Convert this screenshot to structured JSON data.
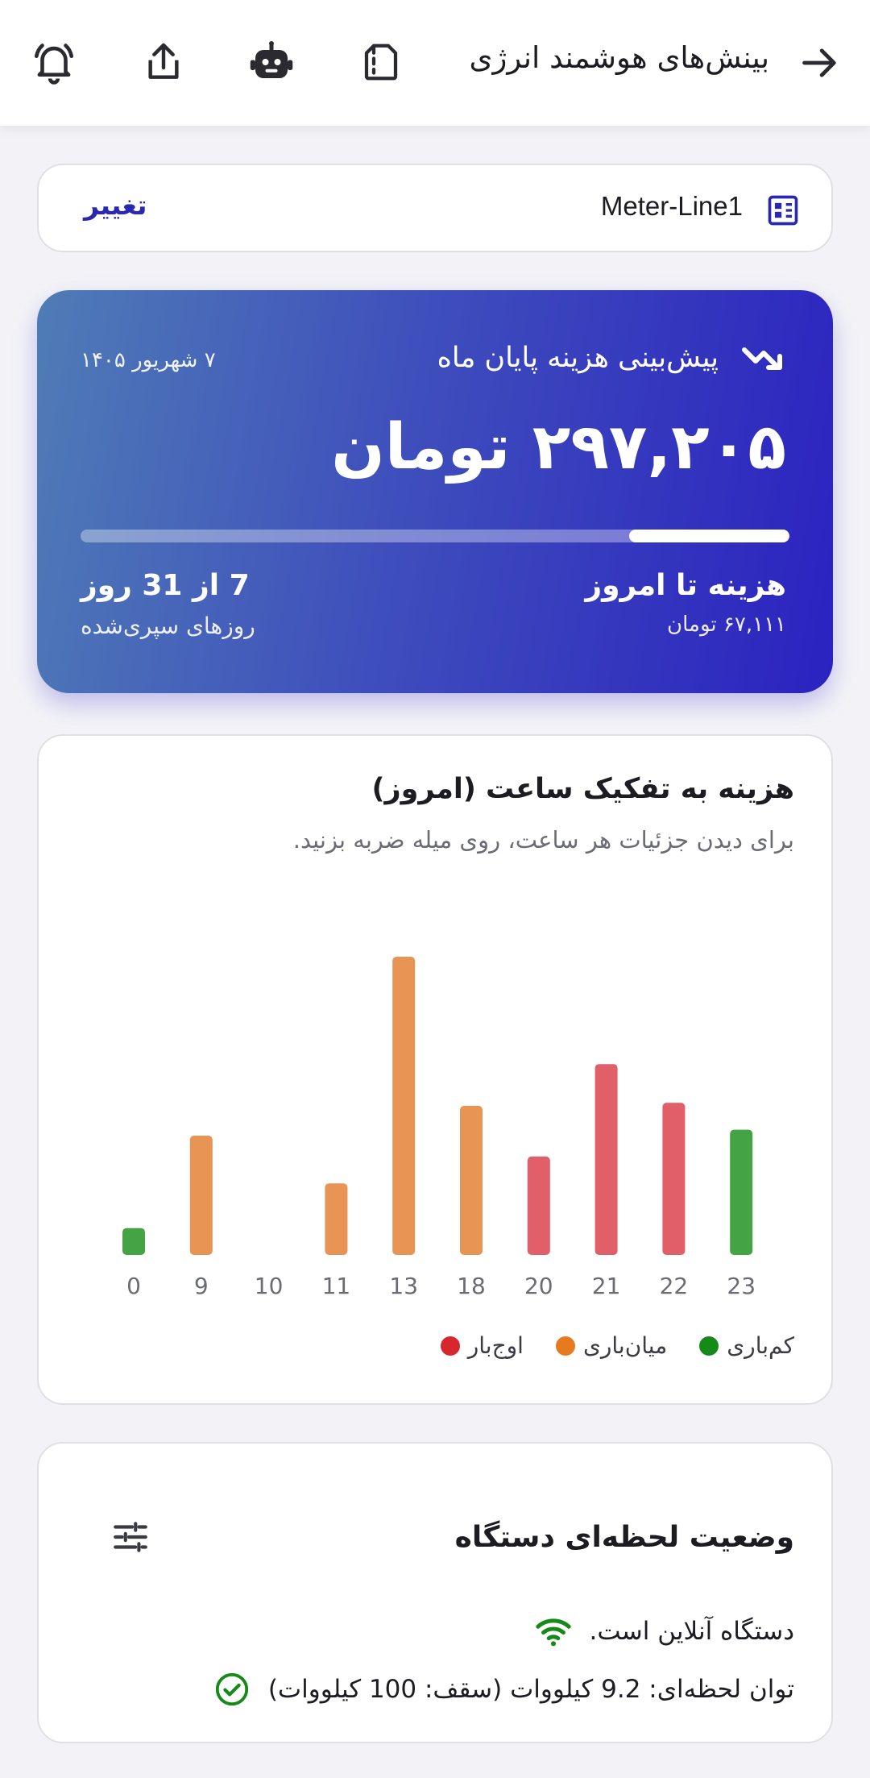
{
  "header": {
    "title": "بینش‌های هوشمند انرژی",
    "icons": [
      "arrow-forward-icon",
      "document-icon",
      "robot-icon",
      "share-icon",
      "bell-icon"
    ]
  },
  "meter": {
    "name": "Meter-Line1",
    "change_label": "تغییر"
  },
  "forecast": {
    "title": "پیش‌بینی هزینه پایان ماه",
    "date": "۷ شهریور ۱۴۰۵",
    "amount": "۲۹۷,۲۰۵ تومان",
    "progress": 0.226,
    "cost_label": "هزینه تا امروز",
    "cost_value": "۶۷,۱۱۱ تومان",
    "days_label": "7 از 31 روز",
    "days_sub": "روزهای سپری‌شده"
  },
  "chart": {
    "title": "هزینه به تفکیک ساعت (امروز)",
    "subtitle": "برای دیدن جزئیات هر ساعت، روی میله ضربه بزنید.",
    "legend": [
      {
        "label": "اوج‌بار",
        "color": "#d7262e"
      },
      {
        "label": "میان‌باری",
        "color": "#e57a1e"
      },
      {
        "label": "کم‌باری",
        "color": "#168a16"
      }
    ]
  },
  "chart_data": {
    "type": "bar",
    "categories": [
      "0",
      "9",
      "10",
      "11",
      "13",
      "18",
      "20",
      "21",
      "22",
      "23"
    ],
    "values": [
      9,
      40,
      0,
      24,
      100,
      50,
      33,
      64,
      51,
      42
    ],
    "colors": [
      "#44a443",
      "#e89455",
      "#e89455",
      "#e89455",
      "#e89455",
      "#e89455",
      "#e05f69",
      "#e05f69",
      "#e05f69",
      "#44a443"
    ],
    "ylim": [
      0,
      100
    ],
    "grid": false
  },
  "status": {
    "title": "وضعیت لحظه‌ای دستگاه",
    "online_text": "دستگاه آنلاین است.",
    "power_text": "توان لحظه‌ای: 9.2 کیلووات (سقف: 100 کیلووات)"
  }
}
